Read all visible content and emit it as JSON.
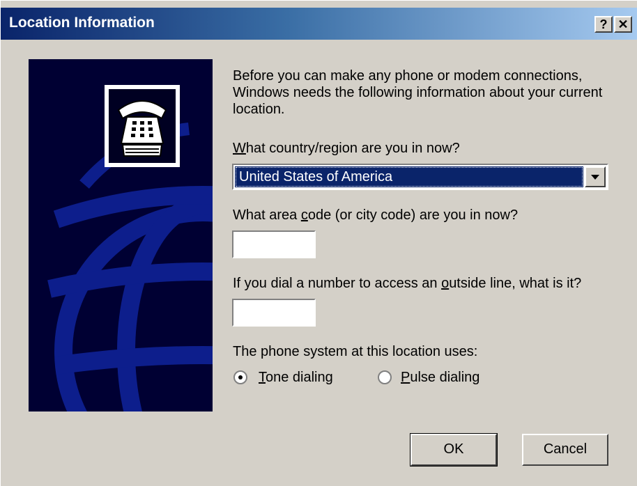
{
  "window": {
    "title": "Location Information",
    "help_glyph": "?",
    "close_glyph": "✕"
  },
  "intro": {
    "lines": [
      "Before you can make any phone or modem connections,",
      "Windows needs the following information about your current",
      "location."
    ]
  },
  "country": {
    "label_key": "W",
    "label_rest": "hat country/region are you in now?",
    "selected": "United States of America"
  },
  "area_code": {
    "label_pre": "What area ",
    "label_key": "c",
    "label_post": "ode (or city code) are you in now?",
    "value": ""
  },
  "outside_line": {
    "label_pre": "If you dial a number to access an ",
    "label_key": "o",
    "label_post": "utside line, what is it?",
    "value": ""
  },
  "dialing": {
    "label": "The phone system at this location uses:",
    "tone_key": "T",
    "tone_rest": "one dialing",
    "pulse_key": "P",
    "pulse_rest": "ulse dialing",
    "selected": "tone"
  },
  "buttons": {
    "ok": "OK",
    "cancel": "Cancel"
  },
  "colors": {
    "title_start": "#0a246a",
    "title_end": "#a6caf0",
    "dialog_face": "#d4d0c8",
    "banner_bg": "#000033",
    "globe_lines": "#0d1e8c",
    "selection": "#0a246a"
  },
  "icons": {
    "banner": "phone-globe-icon",
    "dropdown": "chevron-down-icon"
  }
}
